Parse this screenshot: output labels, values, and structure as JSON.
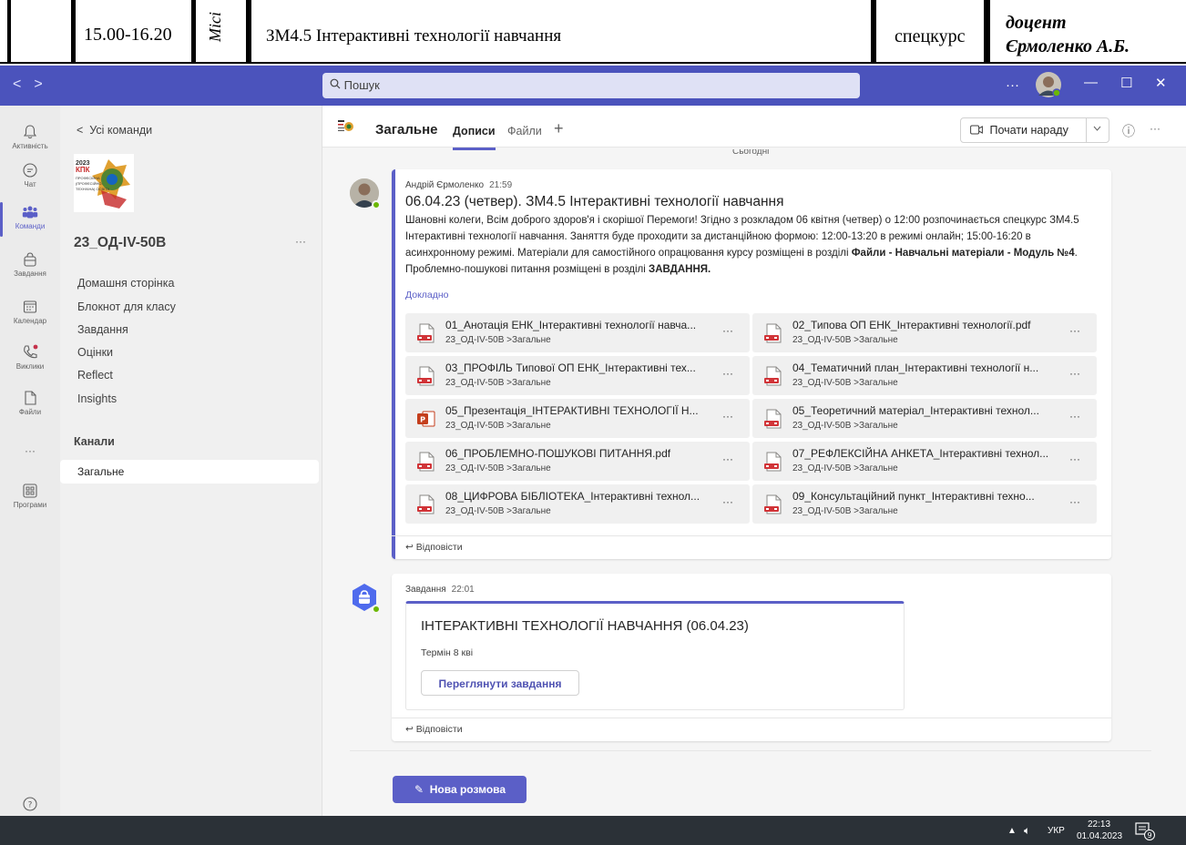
{
  "schedule": {
    "time": "15.00-16.20",
    "location": "Місі",
    "course": "ЗМ4.5 Інтерактивні технології навчання",
    "type": "спецкурс",
    "lecturer_title": "доцент",
    "lecturer_name": "Єрмоленко А.Б."
  },
  "titlebar": {
    "search_placeholder": "Пошук",
    "more": "···",
    "minimize": "—",
    "maximize": "☐",
    "close": "✕"
  },
  "rail": [
    {
      "label": "Активність",
      "icon": "bell-icon"
    },
    {
      "label": "Чат",
      "icon": "chat-icon"
    },
    {
      "label": "Команди",
      "icon": "teams-icon"
    },
    {
      "label": "Завдання",
      "icon": "assignments-icon"
    },
    {
      "label": "Календар",
      "icon": "calendar-icon"
    },
    {
      "label": "Виклики",
      "icon": "phone-icon"
    },
    {
      "label": "Файли",
      "icon": "file-icon"
    },
    {
      "label": "···",
      "icon": "more-icon"
    },
    {
      "label": "Програми",
      "icon": "apps-icon"
    }
  ],
  "team": {
    "back": "Усі команди",
    "logo_text": "2023 КПК ПРОФЕСІЙНА (ПРОФЕСІЙНО-ТЕХНІЧНА) ОСВІТА",
    "name": "23_ОД-IV-50В",
    "more": "···",
    "menu": [
      "Домашня сторінка",
      "Блокнот для класу",
      "Завдання",
      "Оцінки",
      "Reflect",
      "Insights"
    ],
    "channels_label": "Канали",
    "channel": "Загальне"
  },
  "header": {
    "channel": "Загальне",
    "tabs": [
      "Дописи",
      "Файли"
    ],
    "add": "+",
    "meet_label": "Почати нараду",
    "info": "ⓘ",
    "more": "···",
    "date_divider": "Сьогодні"
  },
  "post": {
    "author": "Андрій Єрмоленко",
    "time": "21:59",
    "subject": "06.04.23 (четвер). ЗМ4.5 Інтерактивні технології навчання",
    "body_1": "Шановні колеги, Всім доброго здоров'я і скорішої Перемоги! Згідно з розкладом 06 квітня (четвер) о 12:00 розпочинається спецкурс ЗМ4.5 Інтерактивні технології навчання. Заняття буде проходити за дистанційною формою: 12:00-13:20 в режимі онлайн; 15:00-16:20 в асинхронному режимі. Матеріали для самостійного опрацювання курсу розміщені в розділі ",
    "body_bold_1": "Файли - Навчальні матеріали - Модуль №4",
    "body_2": ". Проблемно-пошукові питання розміщені в розділі ",
    "body_bold_2": "ЗАВДАННЯ.",
    "more_link": "Докладно",
    "files": [
      {
        "name": "01_Анотація ЕНК_Інтерактивні технології навча...",
        "path": "23_ОД-IV-50В >Загальне",
        "icon": "pdf-icon"
      },
      {
        "name": "02_Типова ОП ЕНК_Інтерактивні технології.pdf",
        "path": "23_ОД-IV-50В >Загальне",
        "icon": "pdf-icon"
      },
      {
        "name": "03_ПРОФІЛЬ Типової ОП ЕНК_Інтерактивні тех...",
        "path": "23_ОД-IV-50В >Загальне",
        "icon": "pdf-icon"
      },
      {
        "name": "04_Тематичний план_Інтерактивні технології н...",
        "path": "23_ОД-IV-50В >Загальне",
        "icon": "pdf-icon"
      },
      {
        "name": "05_Презентація_ІНТЕРАКТИВНІ ТЕХНОЛОГІЇ Н...",
        "path": "23_ОД-IV-50В >Загальне",
        "icon": "powerpoint-icon"
      },
      {
        "name": "05_Теоретичний матеріал_Інтерактивні технол...",
        "path": "23_ОД-IV-50В >Загальне",
        "icon": "pdf-icon"
      },
      {
        "name": "06_ПРОБЛЕМНО-ПОШУКОВІ ПИТАННЯ.pdf",
        "path": "23_ОД-IV-50В >Загальне",
        "icon": "pdf-icon"
      },
      {
        "name": "07_РЕФЛЕКСІЙНА АНКЕТА_Інтерактивні технол...",
        "path": "23_ОД-IV-50В >Загальне",
        "icon": "pdf-icon"
      },
      {
        "name": "08_ЦИФРОВА БІБЛІОТЕКА_Інтерактивні технол...",
        "path": "23_ОД-IV-50В >Загальне",
        "icon": "pdf-icon"
      },
      {
        "name": "09_Консультаційний пункт_Інтерактивні техно...",
        "path": "23_ОД-IV-50В >Загальне",
        "icon": "pdf-icon"
      }
    ],
    "file_more": "···",
    "reply": "Відповісти"
  },
  "task": {
    "author": "Завдання",
    "time": "22:01",
    "title": "ІНТЕРАКТИВНІ ТЕХНОЛОГІЇ НАВЧАННЯ (06.04.23)",
    "due": "Термін 8 кві",
    "button": "Переглянути завдання",
    "reply": "Відповісти"
  },
  "new_conversation": "Нова розмова",
  "help": "?",
  "taskbar": {
    "lang": "УКР",
    "time": "22:13",
    "date": "01.04.2023",
    "notifications": "9"
  },
  "colors": {
    "brand": "#5b5fc7",
    "titlebar": "#4b53bc",
    "taskbar": "#2b3137",
    "presence": "#6bb700"
  }
}
